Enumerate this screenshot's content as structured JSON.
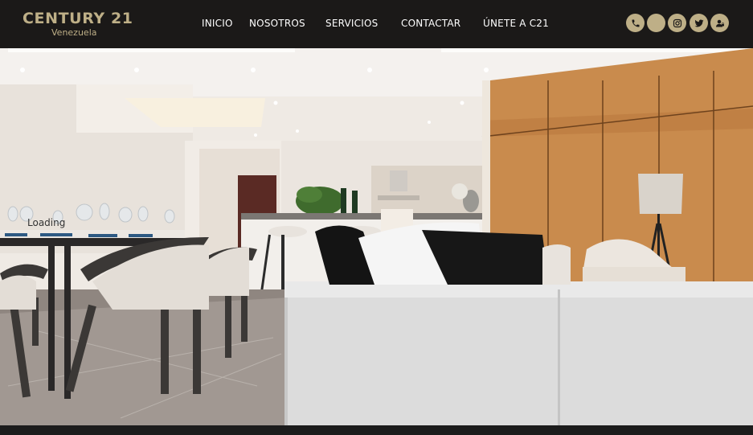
{
  "brand": {
    "name": "CENTURY 21",
    "subtitle": "Venezuela",
    "color": "#beaf87"
  },
  "nav": {
    "items": [
      {
        "label": "INICIO"
      },
      {
        "label": "NOSOTROS"
      },
      {
        "label": "SERVICIOS"
      },
      {
        "label": "CONTACTAR"
      },
      {
        "label": "ÚNETE A C21"
      }
    ]
  },
  "social": {
    "icons": [
      "phone-icon",
      "blank-social-icon",
      "instagram-icon",
      "twitter-icon",
      "user-account-icon"
    ]
  },
  "hero": {
    "status": "Loading"
  },
  "colors": {
    "topbar": "#1b1918",
    "accent": "#beaf87",
    "nav_text": "#ffffff"
  }
}
